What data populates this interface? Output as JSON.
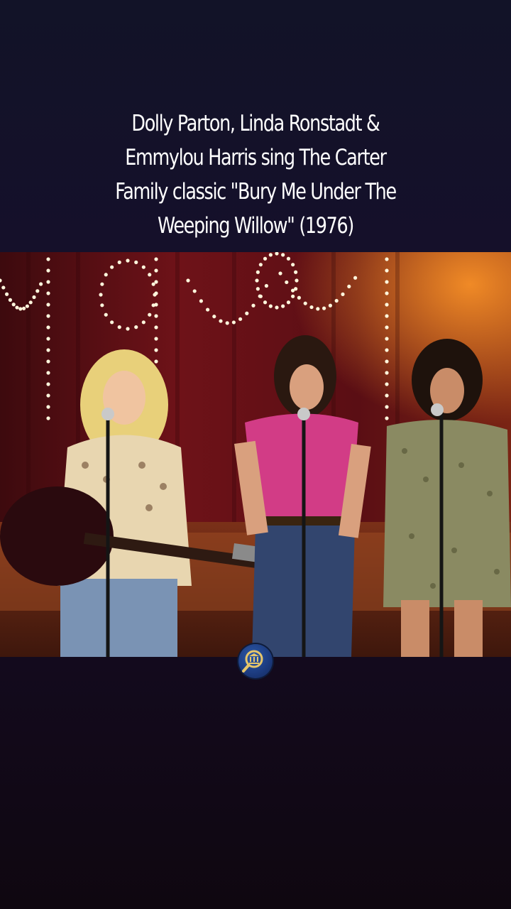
{
  "post": {
    "caption_lines": [
      "Dolly Parton, Linda Ronstadt &",
      "Emmylou Harris sing The Carter",
      "Family classic \"Bury Me Under The",
      "Weeping Willow\" (1976)"
    ]
  },
  "media": {
    "badge_icon": "museum-magnifier-icon",
    "colors": {
      "backdrop": "#6a1016",
      "lights": "#fff6dc",
      "stage": "#8a3a1c"
    }
  }
}
